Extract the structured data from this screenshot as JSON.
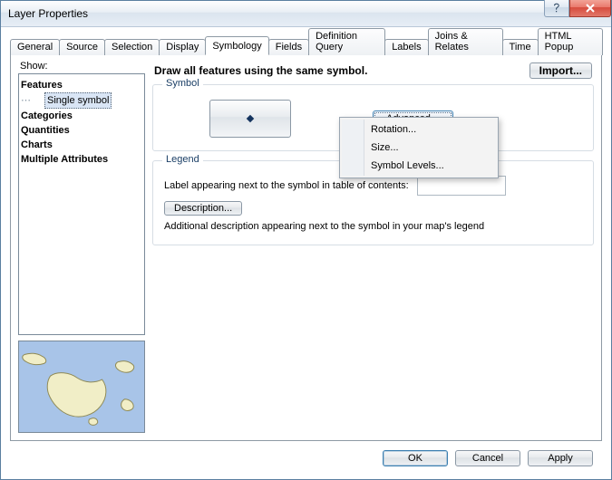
{
  "window": {
    "title": "Layer Properties"
  },
  "tabs": [
    {
      "label": "General"
    },
    {
      "label": "Source"
    },
    {
      "label": "Selection"
    },
    {
      "label": "Display"
    },
    {
      "label": "Symbology",
      "active": true
    },
    {
      "label": "Fields"
    },
    {
      "label": "Definition Query"
    },
    {
      "label": "Labels"
    },
    {
      "label": "Joins & Relates"
    },
    {
      "label": "Time"
    },
    {
      "label": "HTML Popup"
    }
  ],
  "show": {
    "label": "Show:",
    "items": [
      {
        "label": "Features",
        "bold": true
      },
      {
        "label": "Single symbol",
        "indent": true,
        "selected": true
      },
      {
        "label": "Categories",
        "bold": true
      },
      {
        "label": "Quantities",
        "bold": true
      },
      {
        "label": "Charts",
        "bold": true
      },
      {
        "label": "Multiple Attributes",
        "bold": true
      }
    ]
  },
  "header": {
    "text": "Draw all features using the same symbol.",
    "import_label": "Import..."
  },
  "symbol": {
    "title": "Symbol",
    "advanced_label": "Advanced",
    "menu": [
      "Rotation...",
      "Size...",
      "Symbol Levels..."
    ]
  },
  "legend": {
    "title": "Legend",
    "label_text": "Label appearing next to the symbol in table of contents:",
    "description_button": "Description...",
    "desc_text": "Additional description appearing next to the symbol in your map's legend"
  },
  "buttons": {
    "ok": "OK",
    "cancel": "Cancel",
    "apply": "Apply"
  }
}
